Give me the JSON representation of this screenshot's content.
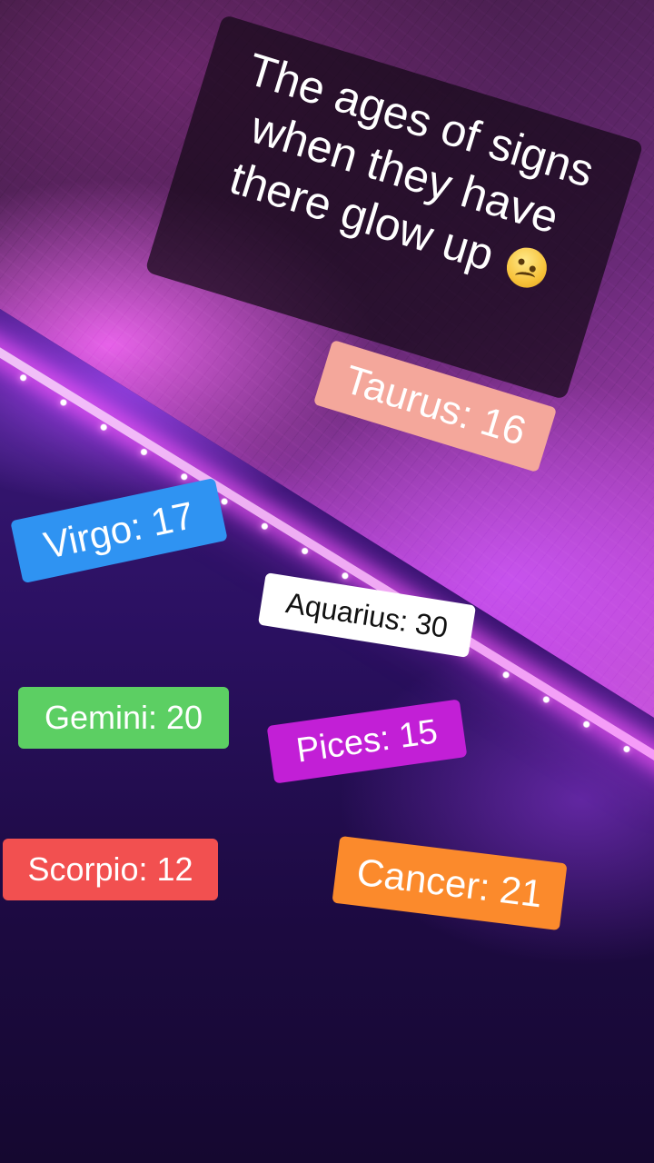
{
  "caption": {
    "text": "The ages of signs when they have there glow up",
    "emoji": "woozy-face-emoji"
  },
  "signs": [
    {
      "label": "Taurus: 16",
      "color": "#f4a79b"
    },
    {
      "label": "Virgo: 17",
      "color": "#2f93f2"
    },
    {
      "label": "Aquarius: 30",
      "color": "#ffffff"
    },
    {
      "label": "Gemini: 20",
      "color": "#5ccf63"
    },
    {
      "label": "Pices: 15",
      "color": "#c21fd6"
    },
    {
      "label": "Scorpio: 12",
      "color": "#f25050"
    },
    {
      "label": "Cancer: 21",
      "color": "#fb8a2c"
    }
  ]
}
